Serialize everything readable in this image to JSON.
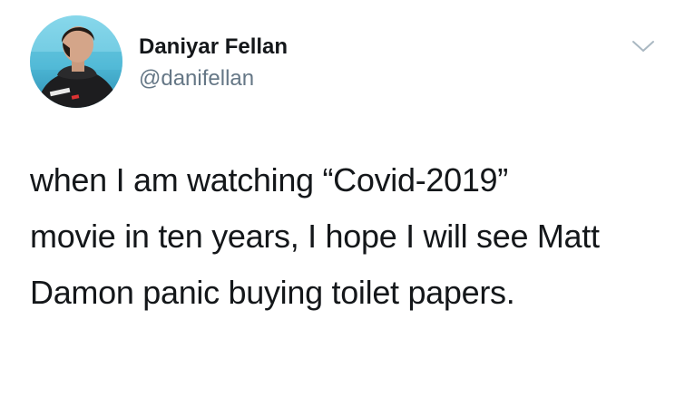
{
  "tweet": {
    "author": {
      "display_name": "Daniyar Fellan",
      "handle": "@danifellan",
      "avatar_icon": "profile-photo-icon"
    },
    "menu_icon": "chevron-down-icon",
    "text_lines": [
      "when I am watching “Covid-2019”",
      "movie in ten years, I hope I will see Matt",
      "Damon panic buying toilet papers."
    ]
  },
  "colors": {
    "text": "#14171a",
    "secondary_text": "#657786",
    "chevron": "#aab8c2",
    "background": "#ffffff"
  }
}
